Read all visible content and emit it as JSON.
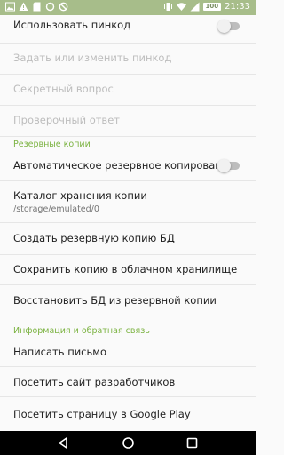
{
  "status_bar": {
    "time": "21:33",
    "battery": "100",
    "colors": {
      "background": "#a7bd8a"
    },
    "left_icons": [
      "image-icon",
      "warning-icon",
      "sd-card-icon",
      "sync-icon",
      "ban-icon"
    ],
    "right_icons": [
      "vibrate-icon",
      "wifi-icon",
      "signal-icon",
      "battery-icon"
    ]
  },
  "settings": {
    "use_pin": {
      "title": "Использовать пинкод",
      "enabled": false
    },
    "set_pin": {
      "title": "Задать или изменить пинкод"
    },
    "secret_question": {
      "title": "Секретный вопрос"
    },
    "check_answer": {
      "title": "Проверочный ответ"
    },
    "backup_header": "Резервные копии",
    "auto_backup": {
      "title": "Автоматическое резервное копирование",
      "enabled": false
    },
    "backup_dir": {
      "title": "Каталог хранения копии",
      "summary": "/storage/emulated/0"
    },
    "create_backup": {
      "title": "Создать резервную копию БД"
    },
    "cloud_backup": {
      "title": "Сохранить копию в облачном хранилище"
    },
    "restore_backup": {
      "title": "Восстановить БД из резервной копии"
    },
    "info_header": "Информация и обратная связь",
    "write_email": {
      "title": "Написать письмо"
    },
    "developer_site": {
      "title": "Посетить сайт разработчиков"
    },
    "google_play": {
      "title": "Посетить страницу в Google Play"
    }
  },
  "navigation": {
    "back": "back-icon",
    "home": "home-icon",
    "recents": "recents-icon"
  },
  "colors": {
    "accent": "#7cb342",
    "disabled_text": "#bdbdbd"
  }
}
